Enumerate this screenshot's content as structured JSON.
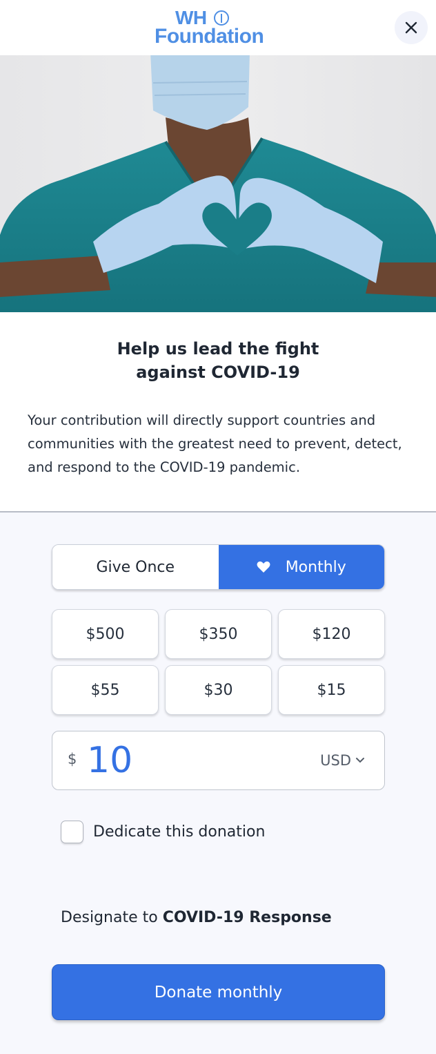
{
  "header": {
    "logo_line1": "WH",
    "logo_line2": "Foundation",
    "close_icon": "close-x-icon"
  },
  "hero": {
    "image_description": "Healthcare worker in teal scrubs and face mask making a heart shape with gloved hands"
  },
  "intro": {
    "headline_line1": "Help us lead the fight",
    "headline_line2": "against COVID-19",
    "description": "Your contribution will directly support countries and communities with the greatest need to prevent, detect, and respond to the COVID-19 pandemic."
  },
  "frequency": {
    "options": [
      {
        "label": "Give Once",
        "selected": false
      },
      {
        "label": "Monthly",
        "selected": true,
        "icon": "heart-icon"
      }
    ]
  },
  "amounts": [
    "$500",
    "$350",
    "$120",
    "$55",
    "$30",
    "$15"
  ],
  "amount_input": {
    "currency_symbol": "$",
    "value": "10",
    "currency": "USD"
  },
  "dedicate": {
    "label": "Dedicate this donation",
    "checked": false
  },
  "designate": {
    "prefix": "Designate to",
    "fund": "COVID-19 Response"
  },
  "submit": {
    "label": "Donate monthly"
  },
  "colors": {
    "accent": "#3471e3",
    "logo": "#4f8fe4",
    "form_background": "#f7f8fd"
  }
}
